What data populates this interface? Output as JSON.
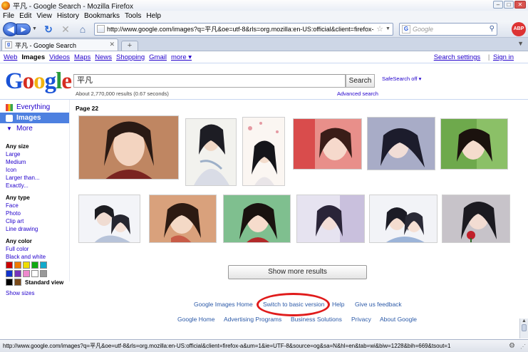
{
  "window": {
    "title": "平凡 - Google Search - Mozilla Firefox",
    "controls": [
      "–",
      "□",
      "✕"
    ]
  },
  "menu": [
    "File",
    "Edit",
    "View",
    "History",
    "Bookmarks",
    "Tools",
    "Help"
  ],
  "nav": {
    "url": "http://www.google.com/images?q=平凡&oe=utf-8&rls=org.mozilla:en-US:official&client=firefox-a&um=1&",
    "search_placeholder": "Google",
    "search_engine_badge": "G",
    "abp_label": "ABP"
  },
  "tab": {
    "title": "平凡 - Google Search",
    "new_tab": "+"
  },
  "gbar": {
    "items": [
      "Web",
      "Images",
      "Videos",
      "Maps",
      "News",
      "Shopping",
      "Gmail",
      "more ▾"
    ],
    "selected": "Images",
    "search_settings": "Search settings",
    "sign_in": "Sign in",
    "separator": "|"
  },
  "logo": [
    "G",
    "o",
    "o",
    "g",
    "l",
    "e"
  ],
  "logo_colors": [
    "#1a53d6",
    "#d62d20",
    "#f2b30f",
    "#1a53d6",
    "#2a9a3c",
    "#d62d20"
  ],
  "search": {
    "query": "平凡",
    "button": "Search",
    "safesearch": "SafeSearch off ▾",
    "results": "About 2,770,000 results (0.67 seconds)",
    "advanced": "Advanced search"
  },
  "leftnav": {
    "items": [
      "Everything",
      "Images",
      "More"
    ],
    "filters": [
      {
        "heading": "Any size",
        "links": [
          "Large",
          "Medium",
          "Icon",
          "Larger than...",
          "Exactly..."
        ]
      },
      {
        "heading": "Any type",
        "links": [
          "Face",
          "Photo",
          "Clip art",
          "Line drawing"
        ]
      },
      {
        "heading": "Any color",
        "links": [
          "Full color",
          "Black and white"
        ]
      }
    ],
    "colors": [
      "#cc0000",
      "#ee7a00",
      "#eedd00",
      "#11aa11",
      "#11aacc",
      "#1133cc",
      "#7733bb",
      "#ee88cc",
      "#ffffff",
      "#999999",
      "#000000",
      "#7a4a1a"
    ],
    "standard_view": "Standard view",
    "show_sizes": "Show sizes"
  },
  "results": {
    "page_label": "Page 22",
    "show_more": "Show more results"
  },
  "footer": {
    "row1": [
      "Google Images Home",
      "Switch to basic version",
      "Help",
      "Give us feedback"
    ],
    "row2": [
      "Google Home",
      "Advertising Programs",
      "Business Solutions",
      "Privacy",
      "About Google"
    ]
  },
  "status": {
    "text": "http://www.google.com/images?q=平凡&oe=utf-8&rls=org.mozilla:en-US:official&client=firefox-a&um=1&ie=UTF-8&source=og&sa=N&hl=en&tab=wi&biw=1228&bih=669&tsout=1"
  }
}
